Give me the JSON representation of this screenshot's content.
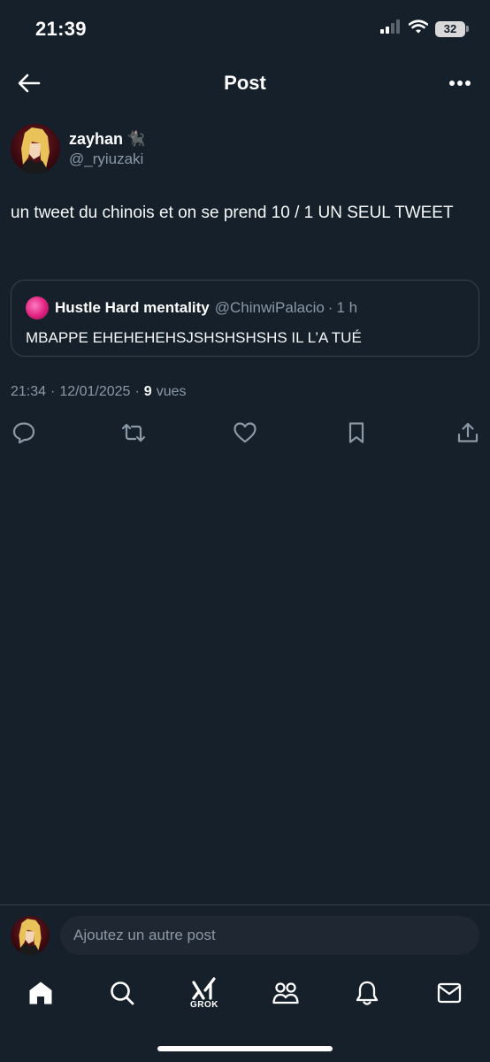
{
  "status_bar": {
    "time": "21:39",
    "battery": "32"
  },
  "header": {
    "title": "Post"
  },
  "post": {
    "author": {
      "display_name": "zayhan",
      "emoji": "🐈‍⬛",
      "handle": "@_ryiuzaki"
    },
    "text": "un tweet du chinois et on se prend 10 / 1 UN SEUL TWEET",
    "quote": {
      "display_name": "Hustle Hard mentality",
      "handle": "@ChinwiPalacio",
      "separator": "·",
      "time": "1 h",
      "text": "MBAPPE EHEHEHEHSJSHSHSHSHS IL L’A TUÉ"
    },
    "meta": {
      "time": "21:34",
      "date": "12/01/2025",
      "views_count": "9",
      "views_label": "vues",
      "separator": "·"
    }
  },
  "reply": {
    "placeholder": "Ajoutez un autre post"
  },
  "nav": {
    "grok_label": "GROK",
    "items": [
      "home-icon",
      "search-icon",
      "grok-icon",
      "communities-icon",
      "notifications-icon",
      "messages-icon"
    ]
  },
  "colors": {
    "background": "#15202b",
    "secondary_text": "#8b98a5",
    "border": "#38444d",
    "input_bg": "#1e2732"
  }
}
